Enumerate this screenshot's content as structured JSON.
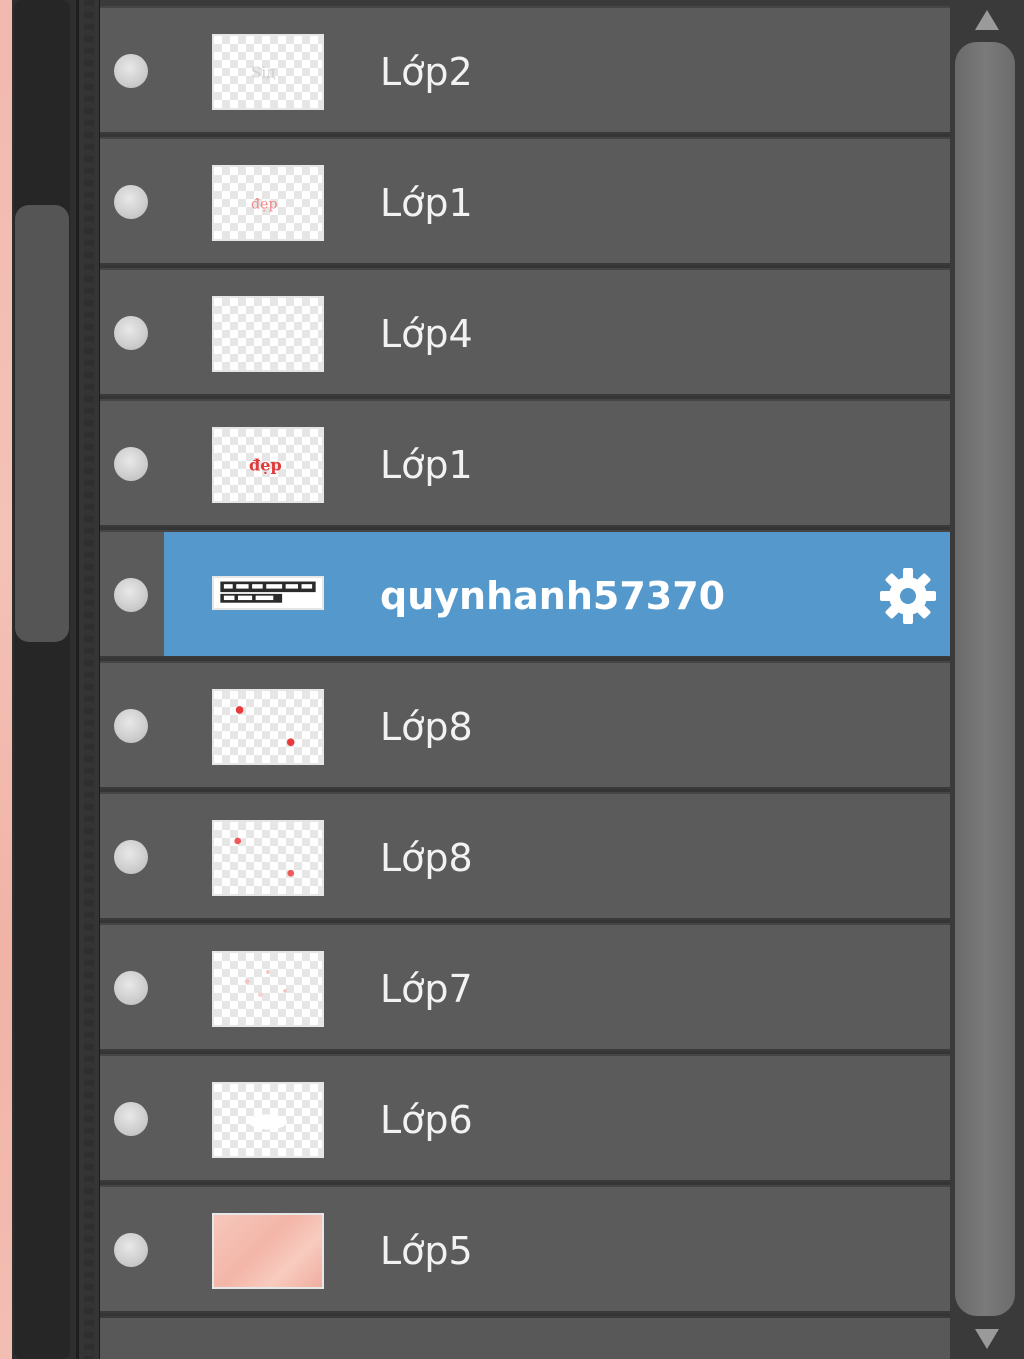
{
  "panel": "layers",
  "layers": [
    {
      "name": "Lớp2",
      "thumbnail": "transparent-faint-text",
      "selected": false
    },
    {
      "name": "Lớp1",
      "thumbnail": "transparent-red-text",
      "selected": false
    },
    {
      "name": "Lớp4",
      "thumbnail": "transparent-empty",
      "selected": false
    },
    {
      "name": "Lớp1",
      "thumbnail": "transparent-red-text-bold",
      "selected": false
    },
    {
      "name": "quynhanh57370",
      "thumbnail": "text-banner",
      "selected": true
    },
    {
      "name": "Lớp8",
      "thumbnail": "transparent-red-dots",
      "selected": false
    },
    {
      "name": "Lớp8",
      "thumbnail": "transparent-red-dots-small",
      "selected": false
    },
    {
      "name": "Lớp7",
      "thumbnail": "transparent-faint-dots",
      "selected": false
    },
    {
      "name": "Lớp6",
      "thumbnail": "transparent-white-blob",
      "selected": false
    },
    {
      "name": "Lớp5",
      "thumbnail": "pink-watercolor",
      "selected": false
    }
  ],
  "icons": {
    "visibility": "visibility-toggle-icon",
    "settings": "gear-icon",
    "scroll_up": "scroll-up-arrow-icon",
    "scroll_down": "scroll-down-arrow-icon"
  },
  "colors": {
    "row_bg": "#5b5b5b",
    "selected_bg": "#5599cc",
    "text": "#f2f2f2",
    "panel_bg": "#353535"
  }
}
